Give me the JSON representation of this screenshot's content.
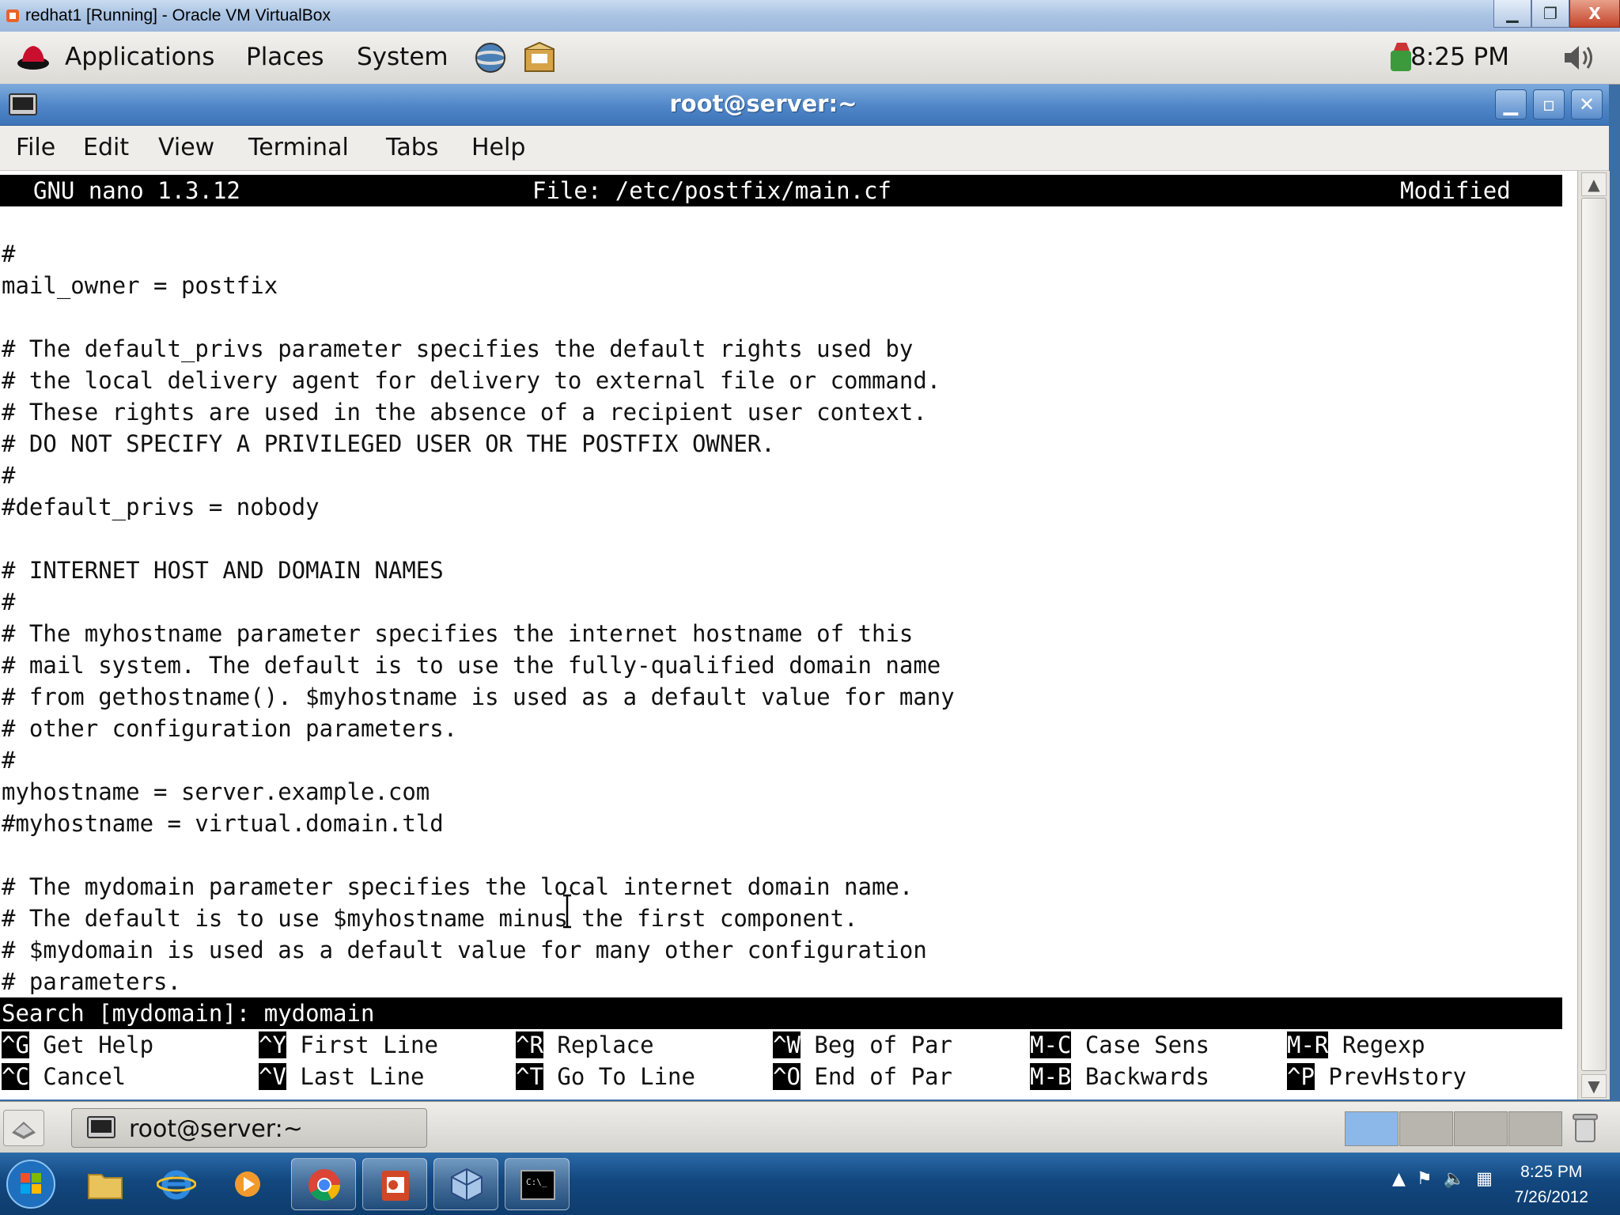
{
  "host": {
    "window_title": "redhat1 [Running] - Oracle VM VirtualBox",
    "minimize": "▁",
    "restore": "❐",
    "close": "X"
  },
  "gnome_panel": {
    "menus": [
      "Applications",
      "Places",
      "System"
    ],
    "clock": "8:25 PM"
  },
  "terminal": {
    "title": "root@server:~",
    "menu": [
      {
        "label": "File"
      },
      {
        "label": "Edit"
      },
      {
        "label": "View"
      },
      {
        "label": "Terminal"
      },
      {
        "label": "Tabs"
      },
      {
        "label": "Help"
      }
    ]
  },
  "nano": {
    "version": "GNU nano 1.3.12",
    "file": "File: /etc/postfix/main.cf",
    "status": "Modified",
    "lines": [
      "",
      "#",
      "mail_owner = postfix",
      "",
      "# The default_privs parameter specifies the default rights used by",
      "# the local delivery agent for delivery to external file or command.",
      "# These rights are used in the absence of a recipient user context.",
      "# DO NOT SPECIFY A PRIVILEGED USER OR THE POSTFIX OWNER.",
      "#",
      "#default_privs = nobody",
      "",
      "# INTERNET HOST AND DOMAIN NAMES",
      "#",
      "# The myhostname parameter specifies the internet hostname of this",
      "# mail system. The default is to use the fully-qualified domain name",
      "# from gethostname(). $myhostname is used as a default value for many",
      "# other configuration parameters.",
      "#",
      "myhostname = server.example.com",
      "#myhostname = virtual.domain.tld",
      "",
      "# The mydomain parameter specifies the local internet domain name.",
      "# The default is to use $myhostname minus the first component.",
      "# $mydomain is used as a default value for many other configuration",
      "# parameters."
    ],
    "search_prompt": "Search [mydomain]: mydomain",
    "shortcuts_row1": [
      {
        "key": "^G",
        "label": " Get Help"
      },
      {
        "key": "^Y",
        "label": " First Line"
      },
      {
        "key": "^R",
        "label": " Replace"
      },
      {
        "key": "^W",
        "label": " Beg of Par"
      },
      {
        "key": "M-C",
        "label": " Case Sens"
      },
      {
        "key": "M-R",
        "label": " Regexp"
      }
    ],
    "shortcuts_row2": [
      {
        "key": "^C",
        "label": " Cancel"
      },
      {
        "key": "^V",
        "label": " Last Line"
      },
      {
        "key": "^T",
        "label": " Go To Line"
      },
      {
        "key": "^O",
        "label": " End of Par"
      },
      {
        "key": "M-B",
        "label": " Backwards"
      },
      {
        "key": "^P",
        "label": " PrevHstory"
      }
    ]
  },
  "gnome_bottom": {
    "task_label": "root@server:~"
  },
  "windows_taskbar": {
    "time": "8:25 PM",
    "date": "7/26/2012",
    "cmd_icon_text": "C:\\_"
  },
  "colors": {
    "terminal_title_blue": "#4f86c8",
    "nano_bar": "#000000",
    "taskbar": "#12477e"
  }
}
